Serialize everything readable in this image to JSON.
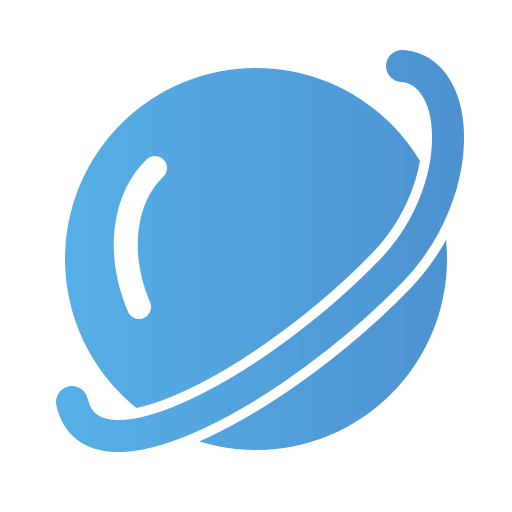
{
  "icon": {
    "name": "planet-icon",
    "colors": {
      "gradient_start": "#56AFE6",
      "gradient_end": "#4D93D1",
      "background": "#FFFFFF"
    }
  }
}
